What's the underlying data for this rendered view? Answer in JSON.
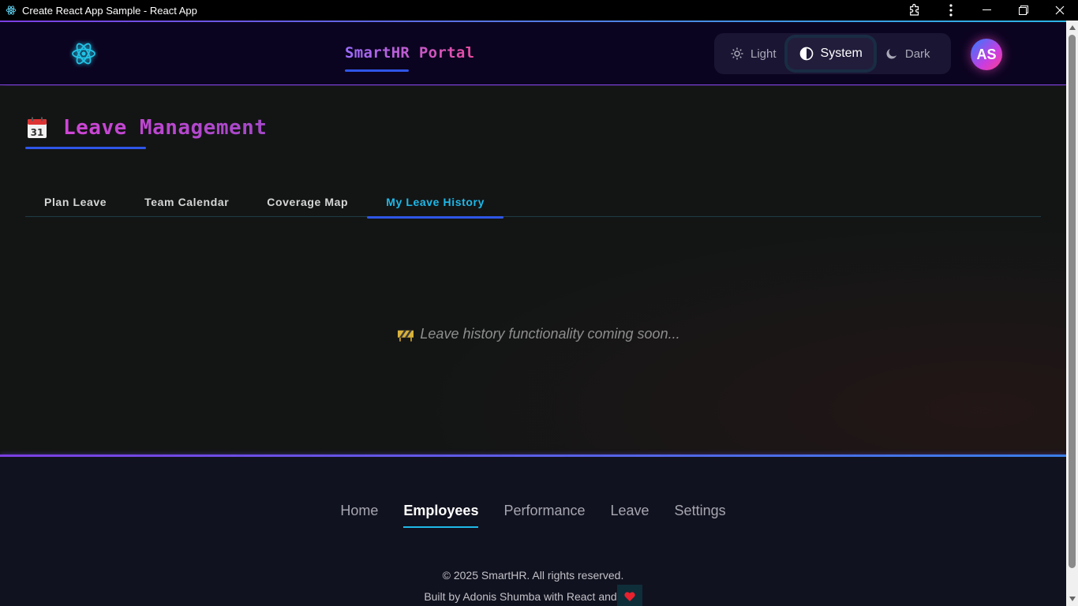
{
  "window": {
    "title": "Create React App Sample - React App"
  },
  "header": {
    "brand": "SmartHR Portal",
    "theme_options": [
      {
        "label": "Light",
        "icon": "sun-icon"
      },
      {
        "label": "System",
        "icon": "half-circle-icon"
      },
      {
        "label": "Dark",
        "icon": "moon-icon"
      }
    ],
    "active_theme": "System",
    "avatar_initials": "AS"
  },
  "main": {
    "title": "Leave Management",
    "title_icon": "calendar-icon",
    "tabs": [
      {
        "label": "Plan Leave"
      },
      {
        "label": "Team Calendar"
      },
      {
        "label": "Coverage Map"
      },
      {
        "label": "My Leave History"
      }
    ],
    "active_tab": "My Leave History",
    "placeholder_text": "Leave history functionality coming soon..."
  },
  "footer": {
    "nav": [
      {
        "label": "Home"
      },
      {
        "label": "Employees"
      },
      {
        "label": "Performance"
      },
      {
        "label": "Leave"
      },
      {
        "label": "Settings"
      }
    ],
    "active_nav": "Employees",
    "copyright": "© 2025 SmartHR. All rights reserved.",
    "built_by": "Built by Adonis Shumba with React and"
  },
  "colors": {
    "accent_blue": "#2f56e8",
    "accent_cyan": "#1fb8e8",
    "accent_purple": "#7b3fe4",
    "heart": "#e8212e"
  }
}
